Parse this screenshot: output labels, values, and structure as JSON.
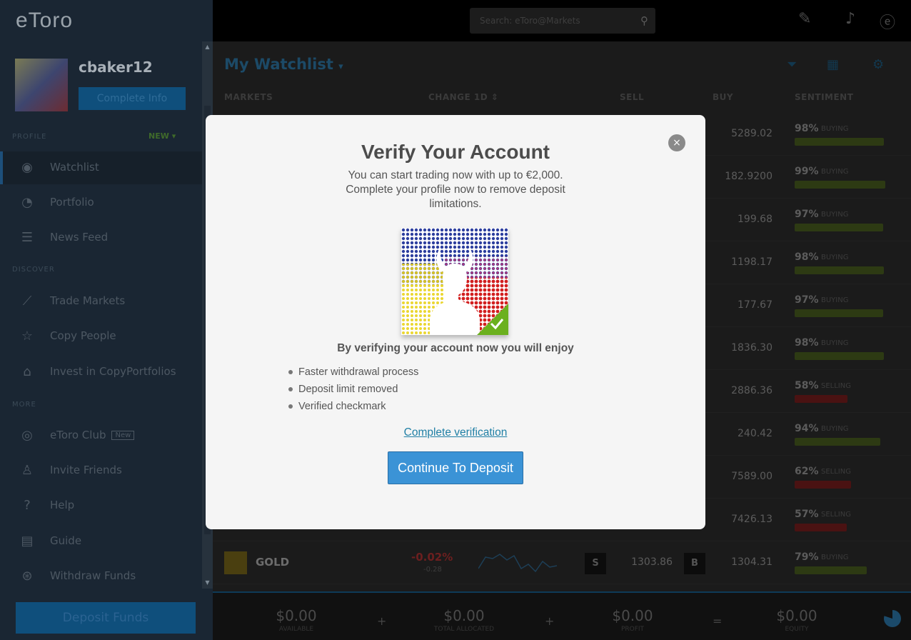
{
  "app": {
    "logo": "eToro",
    "user": {
      "name": "cbaker12",
      "complete_info": "Complete Info"
    },
    "sidebar": {
      "section_1": "PROFILE",
      "new_label": "NEW",
      "items": [
        {
          "label": "Watchlist",
          "icon": "eye-icon"
        },
        {
          "label": "Portfolio",
          "icon": "pie-icon"
        },
        {
          "label": "News Feed",
          "icon": "news-icon"
        }
      ],
      "section_2": "DISCOVER",
      "discover_items": [
        {
          "label": "Trade Markets",
          "icon": "chart-icon"
        },
        {
          "label": "Copy People",
          "icon": "star-people-icon"
        },
        {
          "label": "Invest in CopyPortfolios",
          "icon": "portfolio-icon"
        }
      ],
      "section_3": "MORE",
      "more_items": [
        {
          "label": "eToro Club",
          "icon": "club-icon",
          "badge": "New"
        },
        {
          "label": "Invite Friends",
          "icon": "person-icon"
        },
        {
          "label": "Help",
          "icon": "help-icon"
        },
        {
          "label": "Guide",
          "icon": "guide-icon"
        },
        {
          "label": "Withdraw Funds",
          "icon": "withdraw-icon"
        }
      ],
      "deposit_label": "Deposit Funds"
    },
    "search": {
      "placeholder": "Search: eToro@Markets"
    },
    "watchlist": {
      "title": "My Watchlist",
      "columns": [
        "MARKETS",
        "CHANGE 1D",
        "SELL",
        "BUY",
        "SENTIMENT"
      ],
      "rows": [
        {
          "buy": "5289.02",
          "pct": "98%",
          "word": "BUYING",
          "bar": 0.98,
          "color": "#2d3a13"
        },
        {
          "buy": "182.9200",
          "pct": "99%",
          "word": "BUYING",
          "bar": 0.99,
          "color": "#2d3a13"
        },
        {
          "buy": "199.68",
          "pct": "97%",
          "word": "BUYING",
          "bar": 0.97,
          "color": "#2d3a13"
        },
        {
          "buy": "1198.17",
          "pct": "98%",
          "word": "BUYING",
          "bar": 0.98,
          "color": "#2d3a13"
        },
        {
          "buy": "177.67",
          "pct": "97%",
          "word": "BUYING",
          "bar": 0.97,
          "color": "#2d3a13"
        },
        {
          "buy": "1836.30",
          "pct": "98%",
          "word": "BUYING",
          "bar": 0.98,
          "color": "#2d3a13"
        },
        {
          "buy": "2886.36",
          "pct": "58%",
          "word": "SELLING",
          "bar": 0.58,
          "color": "#4a1212"
        },
        {
          "buy": "240.42",
          "pct": "94%",
          "word": "BUYING",
          "bar": 0.94,
          "color": "#2d3a13"
        },
        {
          "buy": "7589.00",
          "pct": "62%",
          "word": "SELLING",
          "bar": 0.62,
          "color": "#4a1212"
        },
        {
          "buy": "7426.13",
          "pct": "57%",
          "word": "SELLING",
          "bar": 0.57,
          "color": "#4a1212"
        }
      ],
      "gold_row": {
        "name": "GOLD",
        "change": "-0.02%",
        "change_abs": "-0.28",
        "sell": "1303.86",
        "buy": "1304.31",
        "pct": "79%",
        "word": "BUYING",
        "bar": 0.79,
        "sell_btn": "S",
        "buy_btn": "B"
      }
    },
    "summary": {
      "items": [
        {
          "value": "$0.00",
          "label": "AVAILABLE"
        },
        {
          "value": "$0.00",
          "label": "TOTAL ALLOCATED"
        },
        {
          "value": "$0.00",
          "label": "PROFIT"
        },
        {
          "value": "$0.00",
          "label": "EQUITY"
        }
      ],
      "ops": [
        "+",
        "+",
        "="
      ]
    }
  },
  "modal": {
    "title": "Verify Your Account",
    "subtitle": "You can start trading now with up to €2,000. Complete your profile now to remove deposit limitations.",
    "enjoy_heading": "By verifying your account now you will enjoy",
    "benefits": [
      "Faster withdrawal process",
      "Deposit limit removed",
      "Verified checkmark"
    ],
    "complete_link": "Complete verification",
    "continue_button": "Continue To Deposit",
    "close_symbol": "×"
  }
}
